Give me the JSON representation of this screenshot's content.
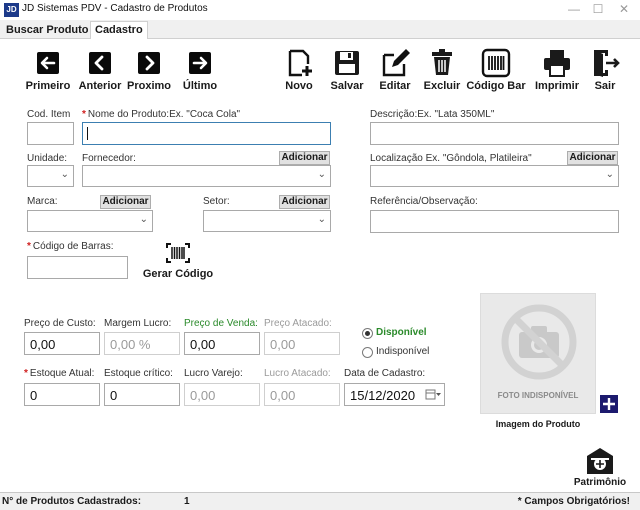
{
  "window": {
    "app_icon": "JD",
    "title": "JD Sistemas PDV - Cadastro de Produtos",
    "minimize_icon": "minimize-icon",
    "maximize_icon": "maximize-icon",
    "close_icon": "close-icon"
  },
  "tabs": [
    {
      "label": "Buscar Produto",
      "active": false
    },
    {
      "label": "Cadastro",
      "active": true
    }
  ],
  "toolbar": {
    "first": {
      "label": "Primeiro",
      "icon": "arrow-left-icon"
    },
    "prev": {
      "label": "Anterior",
      "icon": "chevron-left-icon"
    },
    "next": {
      "label": "Proximo",
      "icon": "chevron-right-icon"
    },
    "last": {
      "label": "Último",
      "icon": "arrow-right-icon"
    },
    "new": {
      "label": "Novo",
      "icon": "new-document-icon"
    },
    "save": {
      "label": "Salvar",
      "icon": "save-icon"
    },
    "edit": {
      "label": "Editar",
      "icon": "edit-icon"
    },
    "delete": {
      "label": "Excluir",
      "icon": "trash-icon"
    },
    "barcode": {
      "label": "Código Bar",
      "icon": "barcode-icon"
    },
    "print": {
      "label": "Imprimir",
      "icon": "printer-icon"
    },
    "exit": {
      "label": "Sair",
      "icon": "exit-icon"
    }
  },
  "form": {
    "cod_item": {
      "label": "Cod. Item",
      "value": ""
    },
    "nome": {
      "label": "Nome do Produto:Ex. \"Coca Cola\"",
      "required": "*",
      "value": ""
    },
    "descricao": {
      "label": "Descrição:Ex. \"Lata 350ML\"",
      "value": ""
    },
    "unidade": {
      "label": "Unidade:",
      "value": ""
    },
    "fornecedor": {
      "label": "Fornecedor:",
      "add": "Adicionar",
      "value": ""
    },
    "localizacao": {
      "label": "Localização Ex. \"Gôndola, Platileira\"",
      "add": "Adicionar",
      "value": ""
    },
    "marca": {
      "label": "Marca:",
      "add": "Adicionar",
      "value": ""
    },
    "setor": {
      "label": "Setor:",
      "add": "Adicionar",
      "value": ""
    },
    "referencia": {
      "label": "Referência/Observação:",
      "value": ""
    },
    "codigo_barras": {
      "label": "Código de Barras:",
      "required": "*",
      "value": ""
    },
    "gerar_codigo": {
      "label": "Gerar Código",
      "icon": "barcode-icon"
    }
  },
  "prices": {
    "preco_custo": {
      "label": "Preço de Custo:",
      "value": "0,00"
    },
    "margem_lucro": {
      "label": "Margem Lucro:",
      "value": "0,00 %"
    },
    "preco_venda": {
      "label": "Preço de Venda:",
      "value": "0,00"
    },
    "preco_atacado": {
      "label": "Preço Atacado:",
      "value": "0,00"
    }
  },
  "availability": {
    "disponivel": {
      "label": "Disponível",
      "checked": true
    },
    "indisponivel": {
      "label": "Indisponível",
      "checked": false
    }
  },
  "stock": {
    "estoque_atual": {
      "label": "Estoque Atual:",
      "required": "*",
      "value": "0"
    },
    "estoque_critico": {
      "label": "Estoque crítico:",
      "value": "0"
    },
    "lucro_varejo": {
      "label": "Lucro Varejo:",
      "value": "0,00"
    },
    "lucro_atacado": {
      "label": "Lucro Atacado:",
      "value": "0,00"
    },
    "data_cadastro": {
      "label": "Data de Cadastro:",
      "value": "15/12/2020",
      "icon": "calendar-icon"
    }
  },
  "photo": {
    "placeholder_text": "FOTO INDISPONÍVEL",
    "caption": "Imagem do Produto",
    "add_icon": "plus-icon",
    "camera_icon": "no-camera-icon"
  },
  "patrimonio": {
    "label": "Patrimônio",
    "icon": "building-icon"
  },
  "status": {
    "count_label": "N° de Produtos Cadastrados:",
    "count_value": "1",
    "required_note": "* Campos Obrigatórios!"
  },
  "colors": {
    "accent_focus": "#3c7fb1",
    "required": "#d02020",
    "price_sale": "#2a8a2a",
    "plus_button": "#1c1a6e"
  }
}
